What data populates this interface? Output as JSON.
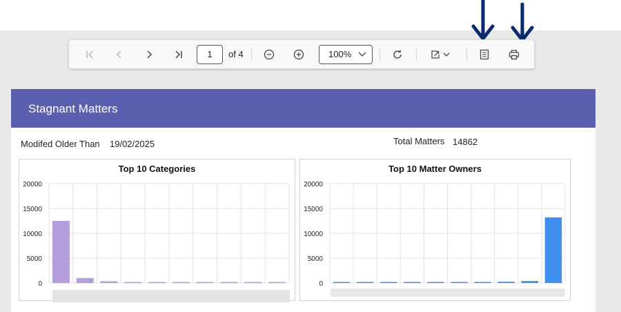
{
  "pager": {
    "page": "1",
    "of_label": "of 4"
  },
  "zoom": {
    "value": "100%"
  },
  "report": {
    "title": "Stagnant Matters",
    "modified_label": "Modifed Older Than",
    "modified_value": "19/02/2025",
    "total_label": "Total Matters",
    "total_value": "14862"
  },
  "colors": {
    "header": "#5b5fb0",
    "arrow": "#0b2a6b",
    "bar_purple": "#b39ddb",
    "bar_blue": "#3f8fef"
  },
  "chart_data": [
    {
      "type": "bar",
      "title": "Top 10 Categories",
      "categories": [
        "",
        "",
        "",
        "",
        "",
        "",
        "",
        "",
        "",
        ""
      ],
      "values": [
        12500,
        1000,
        350,
        120,
        80,
        60,
        50,
        40,
        30,
        20
      ],
      "ylim": [
        0,
        20000
      ],
      "yticks": [
        0,
        5000,
        10000,
        15000,
        20000
      ],
      "grid": true,
      "color": "#b39ddb"
    },
    {
      "type": "bar",
      "title": "Top 10 Matter Owners",
      "categories": [
        "",
        "",
        "",
        "",
        "",
        "",
        "",
        "",
        "",
        ""
      ],
      "values": [
        80,
        90,
        100,
        110,
        130,
        150,
        200,
        250,
        400,
        13200
      ],
      "ylim": [
        0,
        20000
      ],
      "yticks": [
        0,
        5000,
        10000,
        15000,
        20000
      ],
      "grid": true,
      "color": "#3f8fef"
    }
  ]
}
